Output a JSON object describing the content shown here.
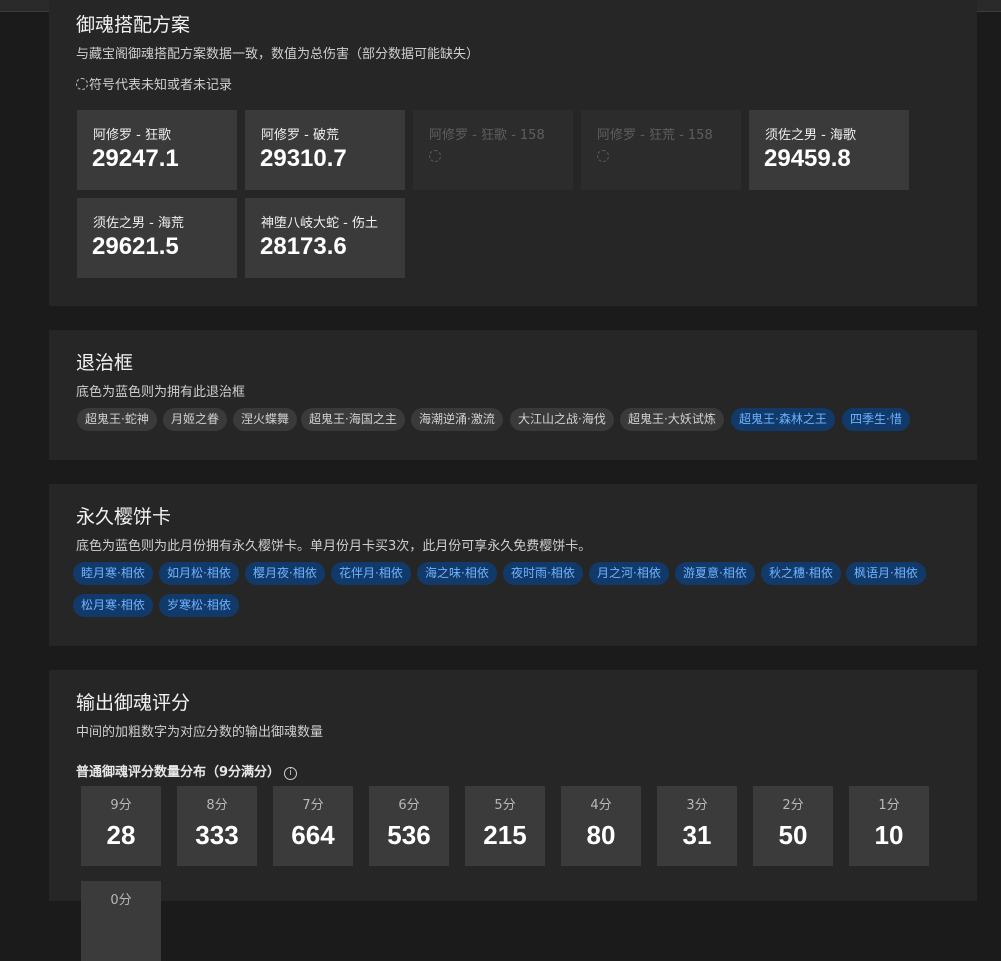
{
  "mitama": {
    "title": "御魂搭配方案",
    "subtitle": "与藏宝阁御魂搭配方案数据一致，数值为总伤害（部分数据可能缺失）",
    "legend": "符号代表未知或者未记录",
    "cards": [
      {
        "label": "阿修罗 - 狂歌",
        "value": "29247.1"
      },
      {
        "label": "阿修罗 - 破荒",
        "value": "29310.7"
      },
      {
        "label": "阿修罗 - 狂歌 - 158",
        "value": ""
      },
      {
        "label": "阿修罗 - 狂荒 - 158",
        "value": ""
      },
      {
        "label": "须佐之男 - 海歌",
        "value": "29459.8"
      },
      {
        "label": "须佐之男 - 海荒",
        "value": "29621.5"
      },
      {
        "label": "神堕八岐大蛇 - 伤土",
        "value": "28173.6"
      }
    ]
  },
  "frames": {
    "title": "退治框",
    "subtitle": "底色为蓝色则为拥有此退治框",
    "tags": [
      {
        "label": "超鬼王·蛇神",
        "owned": false
      },
      {
        "label": "月姬之眷",
        "owned": false
      },
      {
        "label": "涅火蝶舞",
        "owned": false
      },
      {
        "label": "超鬼王·海国之主",
        "owned": false
      },
      {
        "label": "海潮逆涌·激流",
        "owned": false
      },
      {
        "label": "大江山之战·海伐",
        "owned": false
      },
      {
        "label": "超鬼王·大妖试炼",
        "owned": false
      },
      {
        "label": "超鬼王·森林之王",
        "owned": true
      },
      {
        "label": "四季生·惜",
        "owned": true
      }
    ]
  },
  "cards": {
    "title": "永久樱饼卡",
    "subtitle": "底色为蓝色则为此月份拥有永久樱饼卡。单月份月卡买3次，此月份可享永久免费樱饼卡。",
    "tags": [
      {
        "label": "睦月寒·相依",
        "owned": true
      },
      {
        "label": "如月松·相依",
        "owned": true
      },
      {
        "label": "樱月夜·相依",
        "owned": true
      },
      {
        "label": "花伴月·相依",
        "owned": true
      },
      {
        "label": "海之味·相依",
        "owned": true
      },
      {
        "label": "夜时雨·相依",
        "owned": true
      },
      {
        "label": "月之河·相依",
        "owned": true
      },
      {
        "label": "游夏意·相依",
        "owned": true
      },
      {
        "label": "秋之穗·相依",
        "owned": true
      },
      {
        "label": "枫语月·相依",
        "owned": true
      },
      {
        "label": "松月寒·相依",
        "owned": true
      },
      {
        "label": "岁寒松·相依",
        "owned": true
      }
    ]
  },
  "score": {
    "title": "输出御魂评分",
    "subtitle": "中间的加粗数字为对应分数的输出御魂数量",
    "dist_title": "普通御魂评分数量分布（9分满分）",
    "boxes": [
      {
        "label": "9分",
        "value": "28"
      },
      {
        "label": "8分",
        "value": "333"
      },
      {
        "label": "7分",
        "value": "664"
      },
      {
        "label": "6分",
        "value": "536"
      },
      {
        "label": "5分",
        "value": "215"
      },
      {
        "label": "4分",
        "value": "80"
      },
      {
        "label": "3分",
        "value": "31"
      },
      {
        "label": "2分",
        "value": "50"
      },
      {
        "label": "1分",
        "value": "10"
      },
      {
        "label": "0分",
        "value": ""
      }
    ]
  },
  "colors": {
    "owned_bg": "#113a6a",
    "owned_text": "#6fb3ff",
    "unowned_bg": "#3a3a3a"
  }
}
